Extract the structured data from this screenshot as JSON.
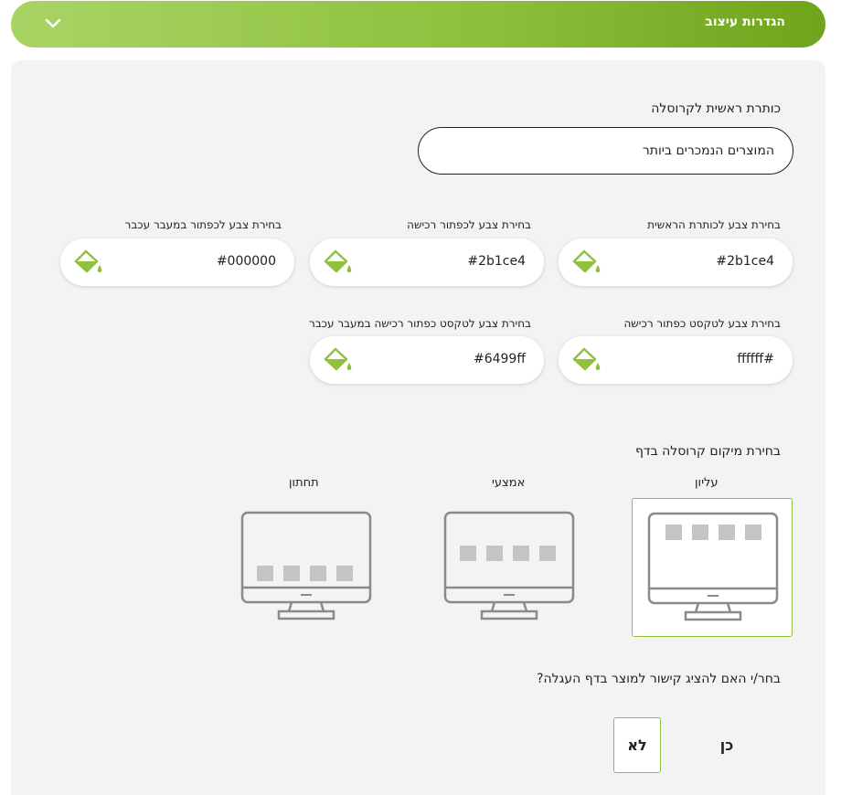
{
  "header": {
    "title": "הגדרות עיצוב",
    "chevron_icon": "chevron-down-icon"
  },
  "carousel_title": {
    "label": "כותרת ראשית לקרוסלה",
    "value": "המוצרים הנמכרים ביותר"
  },
  "colors": [
    {
      "label": "בחירת צבע לכותרת הראשית",
      "value": "#2b1ce4"
    },
    {
      "label": "בחירת צבע לכפתור רכישה",
      "value": "#2b1ce4"
    },
    {
      "label": "בחירת צבע לכפתור במעבר עכבר",
      "value": "#000000"
    },
    {
      "label": "בחירת צבע לטקסט כפתור רכישה",
      "value": "ffffff#"
    },
    {
      "label": "בחירת צבע לטקסט כפתור רכישה במעבר עכבר",
      "value": "#6499ff"
    }
  ],
  "position": {
    "label": "בחירת מיקום קרוסלה בדף",
    "options": [
      {
        "label": "עליון",
        "selected": true
      },
      {
        "label": "אמצעי",
        "selected": false
      },
      {
        "label": "תחתון",
        "selected": false
      }
    ]
  },
  "cart_link": {
    "question": "בחר/י האם להציג קישור למוצר בדף העגלה?",
    "yes": "כן",
    "no": "לא",
    "selected": "no"
  },
  "theme": {
    "accent": "#8fc13e",
    "accent_dark": "#6fa41c",
    "panel_bg": "#f3f3f3"
  }
}
